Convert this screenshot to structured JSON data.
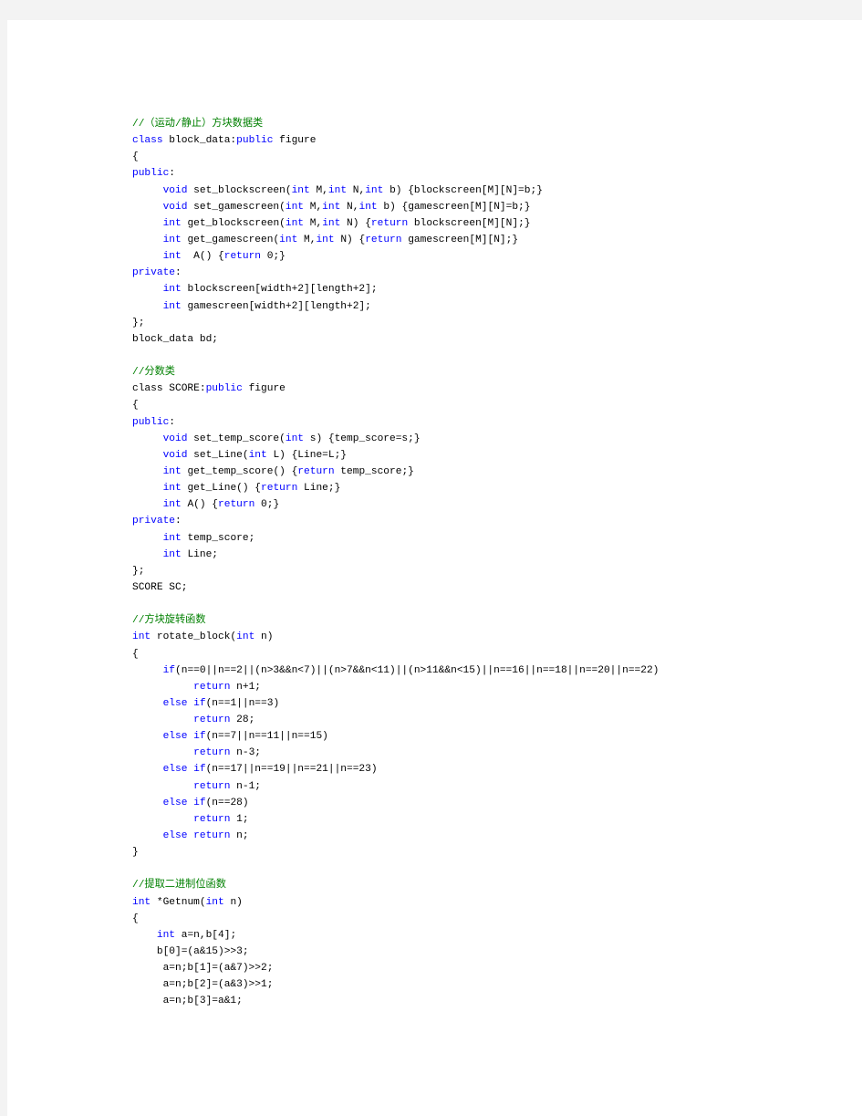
{
  "document": {
    "language": "C++",
    "colors": {
      "keyword": "#0000ff",
      "comment": "#008000",
      "text": "#000000",
      "page": "#ffffff",
      "surround": "#f3f3f3"
    },
    "sections": [
      {
        "name": "block-data-class",
        "lines": [
          [
            [
              "cm",
              "//（运动/静止）方块数据类"
            ]
          ],
          [
            [
              "kw",
              "class"
            ],
            [
              "tx",
              " block_data:"
            ],
            [
              "kw",
              "public"
            ],
            [
              "tx",
              " figure"
            ]
          ],
          [
            [
              "tx",
              "{"
            ]
          ],
          [
            [
              "kw",
              "public"
            ],
            [
              "tx",
              ":"
            ]
          ],
          [
            [
              "tx",
              "     "
            ],
            [
              "kw",
              "void"
            ],
            [
              "tx",
              " set_blockscreen("
            ],
            [
              "kw",
              "int"
            ],
            [
              "tx",
              " M,"
            ],
            [
              "kw",
              "int"
            ],
            [
              "tx",
              " N,"
            ],
            [
              "kw",
              "int"
            ],
            [
              "tx",
              " b) {blockscreen[M][N]=b;}"
            ]
          ],
          [
            [
              "tx",
              "     "
            ],
            [
              "kw",
              "void"
            ],
            [
              "tx",
              " set_gamescreen("
            ],
            [
              "kw",
              "int"
            ],
            [
              "tx",
              " M,"
            ],
            [
              "kw",
              "int"
            ],
            [
              "tx",
              " N,"
            ],
            [
              "kw",
              "int"
            ],
            [
              "tx",
              " b) {gamescreen[M][N]=b;}"
            ]
          ],
          [
            [
              "tx",
              "     "
            ],
            [
              "kw",
              "int"
            ],
            [
              "tx",
              " get_blockscreen("
            ],
            [
              "kw",
              "int"
            ],
            [
              "tx",
              " M,"
            ],
            [
              "kw",
              "int"
            ],
            [
              "tx",
              " N) {"
            ],
            [
              "kw",
              "return"
            ],
            [
              "tx",
              " blockscreen[M][N];}"
            ]
          ],
          [
            [
              "tx",
              "     "
            ],
            [
              "kw",
              "int"
            ],
            [
              "tx",
              " get_gamescreen("
            ],
            [
              "kw",
              "int"
            ],
            [
              "tx",
              " M,"
            ],
            [
              "kw",
              "int"
            ],
            [
              "tx",
              " N) {"
            ],
            [
              "kw",
              "return"
            ],
            [
              "tx",
              " gamescreen[M][N];}"
            ]
          ],
          [
            [
              "tx",
              "     "
            ],
            [
              "kw",
              "int"
            ],
            [
              "tx",
              "  A() {"
            ],
            [
              "kw",
              "return"
            ],
            [
              "tx",
              " 0;}"
            ]
          ],
          [
            [
              "kw",
              "private"
            ],
            [
              "tx",
              ":"
            ]
          ],
          [
            [
              "tx",
              "     "
            ],
            [
              "kw",
              "int"
            ],
            [
              "tx",
              " blockscreen[width+2][length+2];"
            ]
          ],
          [
            [
              "tx",
              "     "
            ],
            [
              "kw",
              "int"
            ],
            [
              "tx",
              " gamescreen[width+2][length+2];"
            ]
          ],
          [
            [
              "tx",
              "};"
            ]
          ],
          [
            [
              "tx",
              "block_data bd;"
            ]
          ],
          [
            [
              "tx",
              ""
            ]
          ]
        ]
      },
      {
        "name": "score-class",
        "lines": [
          [
            [
              "cm",
              "//分数类"
            ]
          ],
          [
            [
              "tx",
              "class SCORE:"
            ],
            [
              "kw",
              "public"
            ],
            [
              "tx",
              " figure"
            ]
          ],
          [
            [
              "tx",
              "{"
            ]
          ],
          [
            [
              "kw",
              "public"
            ],
            [
              "tx",
              ":"
            ]
          ],
          [
            [
              "tx",
              "     "
            ],
            [
              "kw",
              "void"
            ],
            [
              "tx",
              " set_temp_score("
            ],
            [
              "kw",
              "int"
            ],
            [
              "tx",
              " s) {temp_score=s;}"
            ]
          ],
          [
            [
              "tx",
              "     "
            ],
            [
              "kw",
              "void"
            ],
            [
              "tx",
              " set_Line("
            ],
            [
              "kw",
              "int"
            ],
            [
              "tx",
              " L) {Line=L;}"
            ]
          ],
          [
            [
              "tx",
              "     "
            ],
            [
              "kw",
              "int"
            ],
            [
              "tx",
              " get_temp_score() {"
            ],
            [
              "kw",
              "return"
            ],
            [
              "tx",
              " temp_score;}"
            ]
          ],
          [
            [
              "tx",
              "     "
            ],
            [
              "kw",
              "int"
            ],
            [
              "tx",
              " get_Line() {"
            ],
            [
              "kw",
              "return"
            ],
            [
              "tx",
              " Line;}"
            ]
          ],
          [
            [
              "tx",
              "     "
            ],
            [
              "kw",
              "int"
            ],
            [
              "tx",
              " A() {"
            ],
            [
              "kw",
              "return"
            ],
            [
              "tx",
              " 0;}"
            ]
          ],
          [
            [
              "kw",
              "private"
            ],
            [
              "tx",
              ":"
            ]
          ],
          [
            [
              "tx",
              "     "
            ],
            [
              "kw",
              "int"
            ],
            [
              "tx",
              " temp_score;"
            ]
          ],
          [
            [
              "tx",
              "     "
            ],
            [
              "kw",
              "int"
            ],
            [
              "tx",
              " Line;"
            ]
          ],
          [
            [
              "tx",
              "};"
            ]
          ],
          [
            [
              "tx",
              "SCORE SC;"
            ]
          ],
          [
            [
              "tx",
              ""
            ]
          ]
        ]
      },
      {
        "name": "rotate-block-function",
        "lines": [
          [
            [
              "cm",
              "//方块旋转函数"
            ]
          ],
          [
            [
              "kw",
              "int"
            ],
            [
              "tx",
              " rotate_block("
            ],
            [
              "kw",
              "int"
            ],
            [
              "tx",
              " n)"
            ]
          ],
          [
            [
              "tx",
              "{"
            ]
          ],
          [
            [
              "tx",
              "     "
            ],
            [
              "kw",
              "if"
            ],
            [
              "tx",
              "(n==0||n==2||(n>3&&n<7)||(n>7&&n<11)||(n>11&&n<15)||n==16||n==18||n==20||n==22)"
            ]
          ],
          [
            [
              "tx",
              "          "
            ],
            [
              "kw",
              "return"
            ],
            [
              "tx",
              " n+1;"
            ]
          ],
          [
            [
              "tx",
              "     "
            ],
            [
              "kw",
              "else"
            ],
            [
              "tx",
              " "
            ],
            [
              "kw",
              "if"
            ],
            [
              "tx",
              "(n==1||n==3)"
            ]
          ],
          [
            [
              "tx",
              "          "
            ],
            [
              "kw",
              "return"
            ],
            [
              "tx",
              " 28;"
            ]
          ],
          [
            [
              "tx",
              "     "
            ],
            [
              "kw",
              "else"
            ],
            [
              "tx",
              " "
            ],
            [
              "kw",
              "if"
            ],
            [
              "tx",
              "(n==7||n==11||n==15)"
            ]
          ],
          [
            [
              "tx",
              "          "
            ],
            [
              "kw",
              "return"
            ],
            [
              "tx",
              " n-3;"
            ]
          ],
          [
            [
              "tx",
              "     "
            ],
            [
              "kw",
              "else"
            ],
            [
              "tx",
              " "
            ],
            [
              "kw",
              "if"
            ],
            [
              "tx",
              "(n==17||n==19||n==21||n==23)"
            ]
          ],
          [
            [
              "tx",
              "          "
            ],
            [
              "kw",
              "return"
            ],
            [
              "tx",
              " n-1;"
            ]
          ],
          [
            [
              "tx",
              "     "
            ],
            [
              "kw",
              "else"
            ],
            [
              "tx",
              " "
            ],
            [
              "kw",
              "if"
            ],
            [
              "tx",
              "(n==28)"
            ]
          ],
          [
            [
              "tx",
              "          "
            ],
            [
              "kw",
              "return"
            ],
            [
              "tx",
              " 1;"
            ]
          ],
          [
            [
              "tx",
              "     "
            ],
            [
              "kw",
              "else"
            ],
            [
              "tx",
              " "
            ],
            [
              "kw",
              "return"
            ],
            [
              "tx",
              " n;"
            ]
          ],
          [
            [
              "tx",
              "}"
            ]
          ],
          [
            [
              "tx",
              ""
            ]
          ]
        ]
      },
      {
        "name": "getnum-function",
        "lines": [
          [
            [
              "cm",
              "//提取二进制位函数"
            ]
          ],
          [
            [
              "kw",
              "int"
            ],
            [
              "tx",
              " *Getnum("
            ],
            [
              "kw",
              "int"
            ],
            [
              "tx",
              " n)"
            ]
          ],
          [
            [
              "tx",
              "{"
            ]
          ],
          [
            [
              "tx",
              "    "
            ],
            [
              "kw",
              "int"
            ],
            [
              "tx",
              " a=n,b[4];"
            ]
          ],
          [
            [
              "tx",
              "    b[0]=(a&15)>>3;"
            ]
          ],
          [
            [
              "tx",
              "     a=n;b[1]=(a&7)>>2;"
            ]
          ],
          [
            [
              "tx",
              "     a=n;b[2]=(a&3)>>1;"
            ]
          ],
          [
            [
              "tx",
              "     a=n;b[3]=a&1;"
            ]
          ]
        ]
      }
    ]
  }
}
